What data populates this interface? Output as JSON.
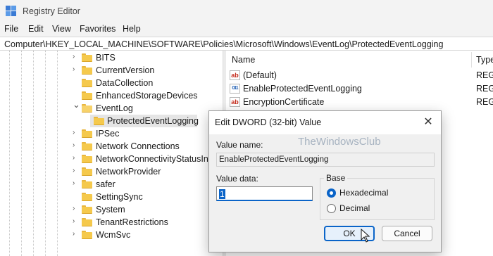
{
  "window": {
    "title": "Registry Editor"
  },
  "menu": [
    "File",
    "Edit",
    "View",
    "Favorites",
    "Help"
  ],
  "address": "Computer\\HKEY_LOCAL_MACHINE\\SOFTWARE\\Policies\\Microsoft\\Windows\\EventLog\\ProtectedEventLogging",
  "tree": {
    "items": [
      {
        "label": "BITS",
        "expander": "collapsed"
      },
      {
        "label": "CurrentVersion",
        "expander": "collapsed"
      },
      {
        "label": "DataCollection",
        "expander": "none"
      },
      {
        "label": "EnhancedStorageDevices",
        "expander": "none"
      },
      {
        "label": "EventLog",
        "expander": "expanded"
      },
      {
        "label": "ProtectedEventLogging",
        "expander": "none",
        "selected": true
      },
      {
        "label": "IPSec",
        "expander": "collapsed"
      },
      {
        "label": "Network Connections",
        "expander": "collapsed"
      },
      {
        "label": "NetworkConnectivityStatusInd",
        "expander": "collapsed"
      },
      {
        "label": "NetworkProvider",
        "expander": "collapsed"
      },
      {
        "label": "safer",
        "expander": "collapsed"
      },
      {
        "label": "SettingSync",
        "expander": "none"
      },
      {
        "label": "System",
        "expander": "collapsed"
      },
      {
        "label": "TenantRestrictions",
        "expander": "collapsed"
      },
      {
        "label": "WcmSvc",
        "expander": "collapsed"
      }
    ]
  },
  "list": {
    "headers": {
      "name": "Name",
      "type": "Type"
    },
    "rows": [
      {
        "name": "(Default)",
        "type": "REG_",
        "icon": "string-value-icon"
      },
      {
        "name": "EnableProtectedEventLogging",
        "type": "REG_",
        "icon": "binary-value-icon"
      },
      {
        "name": "EncryptionCertificate",
        "type": "REG_",
        "icon": "string-value-icon"
      }
    ]
  },
  "dialog": {
    "title": "Edit DWORD (32-bit) Value",
    "value_name_label": "Value name:",
    "value_name": "EnableProtectedEventLogging",
    "value_data_label": "Value data:",
    "value_data": "1",
    "base_label": "Base",
    "base_options": [
      {
        "label": "Hexadecimal",
        "checked": true
      },
      {
        "label": "Decimal",
        "checked": false
      }
    ],
    "ok_label": "OK",
    "cancel_label": "Cancel"
  },
  "watermark": "TheWindowsClub",
  "colors": {
    "accent": "#0a64c8",
    "folder": "#f5c94c",
    "selection": "#e5e5e5"
  }
}
